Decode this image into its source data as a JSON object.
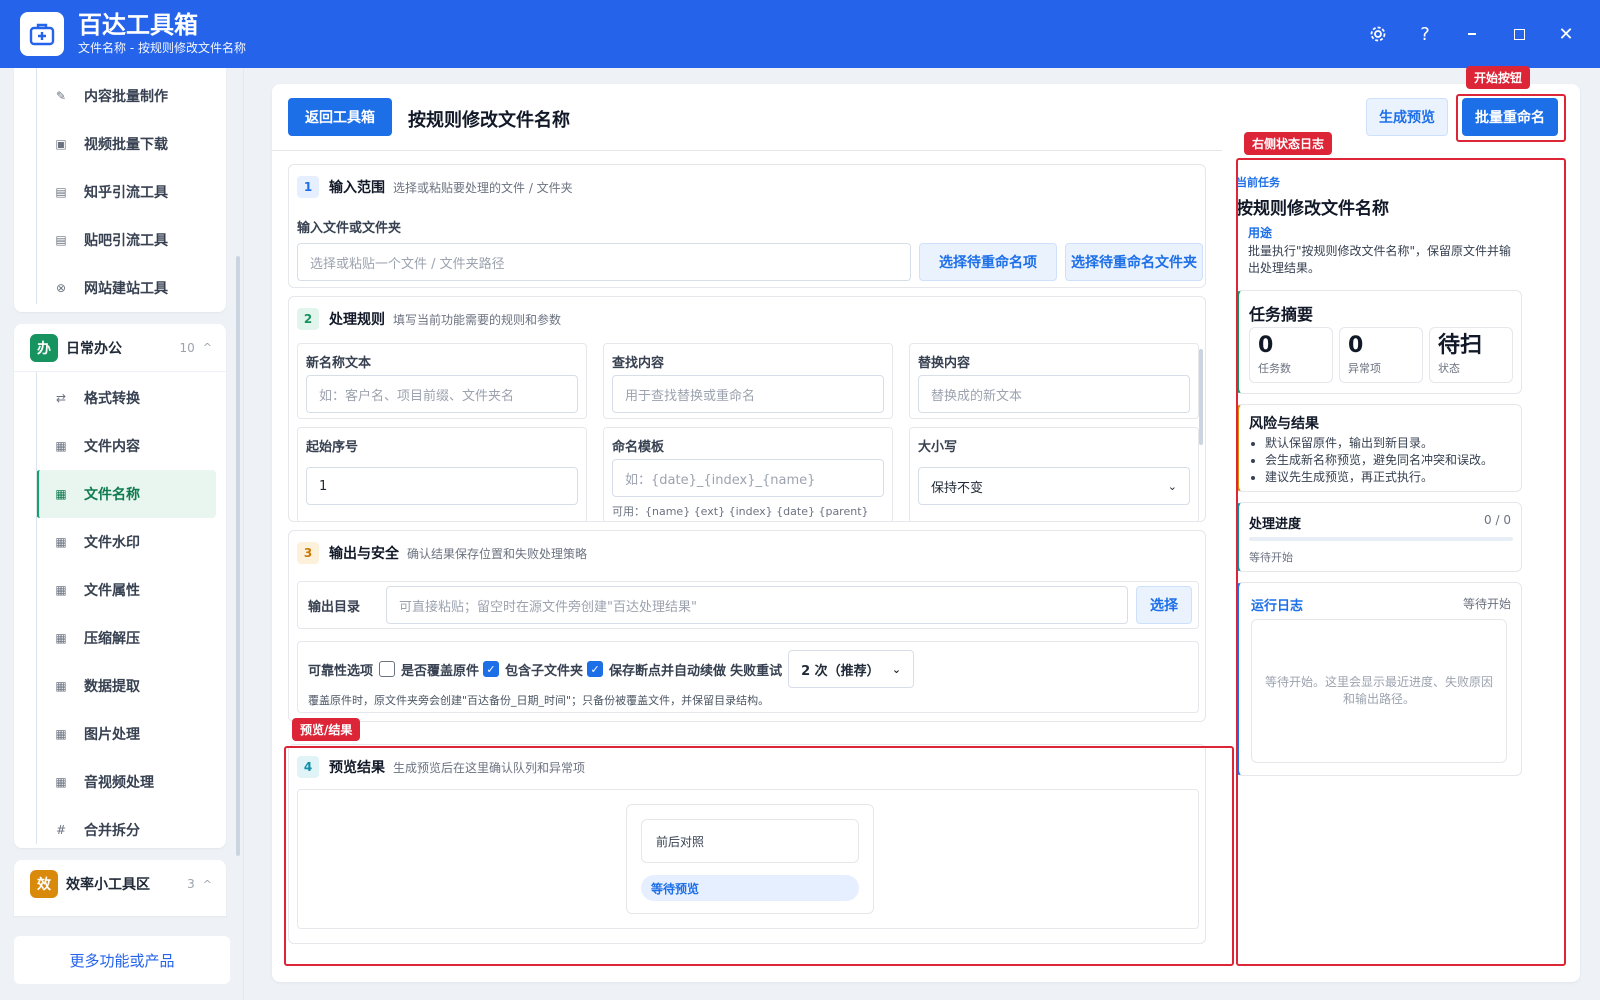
{
  "app": {
    "title": "百达工具箱",
    "subtitle": "文件名称 - 按规则修改文件名称",
    "window_controls": [
      "settings-icon",
      "help-icon",
      "minimize-icon",
      "maximize-icon",
      "close-icon"
    ]
  },
  "sidebar": {
    "top_items": [
      {
        "icon": "edit-icon",
        "label": "内容批量制作"
      },
      {
        "icon": "video-icon",
        "label": "视频批量下载"
      },
      {
        "icon": "zhihu-icon",
        "label": "知乎引流工具"
      },
      {
        "icon": "tieba-icon",
        "label": "贴吧引流工具"
      },
      {
        "icon": "globe-icon",
        "label": "网站建站工具"
      }
    ],
    "group_office": {
      "badge": "办",
      "name": "日常办公",
      "count": "10",
      "items": [
        {
          "icon": "swap-icon",
          "label": "格式转换"
        },
        {
          "icon": "grid-icon",
          "label": "文件内容"
        },
        {
          "icon": "grid-icon",
          "label": "文件名称"
        },
        {
          "icon": "grid-icon",
          "label": "文件水印"
        },
        {
          "icon": "grid-icon",
          "label": "文件属性"
        },
        {
          "icon": "grid-icon",
          "label": "压缩解压"
        },
        {
          "icon": "grid-icon",
          "label": "数据提取"
        },
        {
          "icon": "grid-icon",
          "label": "图片处理"
        },
        {
          "icon": "grid-icon",
          "label": "音视频处理"
        },
        {
          "icon": "hash-icon",
          "label": "合并拆分"
        }
      ],
      "active_index": 2
    },
    "group_efficiency": {
      "badge": "效",
      "name": "效率小工具区",
      "count": "3"
    },
    "more_label": "更多功能或产品"
  },
  "header": {
    "back_label": "返回工具箱",
    "title": "按规则修改文件名称",
    "preview_label": "生成预览",
    "rename_label": "批量重命名"
  },
  "section1": {
    "num": "1",
    "title": "输入范围",
    "desc": "选择或粘贴要处理的文件 / 文件夹",
    "field_label": "输入文件或文件夹",
    "placeholder": "选择或粘贴一个文件 / 文件夹路径",
    "btn_items": "选择待重命名项",
    "btn_folder": "选择待重命名文件夹"
  },
  "section2": {
    "num": "2",
    "title": "处理规则",
    "desc": "填写当前功能需要的规则和参数",
    "fields": {
      "new_name_label": "新名称文本",
      "new_name_placeholder": "如：客户名、项目前缀、文件夹名",
      "find_label": "查找内容",
      "find_placeholder": "用于查找替换或重命名",
      "replace_label": "替换内容",
      "replace_placeholder": "替换成的新文本",
      "start_label": "起始序号",
      "start_value": "1",
      "template_label": "命名模板",
      "template_placeholder": "如：{date}_{index}_{name}",
      "template_hint": "可用：{name} {ext} {index} {date} {parent}",
      "case_label": "大小写",
      "case_value": "保持不变"
    }
  },
  "section3": {
    "num": "3",
    "title": "输出与安全",
    "desc": "确认结果保存位置和失败处理策略",
    "output_label": "输出目录",
    "output_placeholder": "可直接粘贴；留空时在源文件旁创建\"百达处理结果\"",
    "choose_label": "选择",
    "reliability_label": "可靠性选项",
    "opt_overwrite": "是否覆盖原件",
    "opt_subfolders": "包含子文件夹",
    "opt_resume": "保存断点并自动续做",
    "retry_label": "失败重试",
    "retry_value": "2 次（推荐）",
    "note": "覆盖原件时，原文件夹旁会创建\"百达备份_日期_时间\"；只备份被覆盖文件，并保留目录结构。"
  },
  "section4": {
    "num": "4",
    "title": "预览结果",
    "desc": "生成预览后在这里确认队列和异常项",
    "compare_label": "前后对照",
    "waiting_label": "等待预览"
  },
  "annotations": {
    "start_button": "开始按钮",
    "right_log": "右侧状态日志",
    "preview_result": "预览/结果"
  },
  "right_panel": {
    "current_task_label": "当前任务",
    "task_title": "按规则修改文件名称",
    "usage_label": "用途",
    "usage_text": "批量执行\"按规则修改文件名称\"，保留原文件并输出处理结果。",
    "summary_title": "任务摘要",
    "stats": [
      {
        "value": "0",
        "label": "任务数"
      },
      {
        "value": "0",
        "label": "异常项"
      },
      {
        "value": "待扫",
        "label": "状态"
      }
    ],
    "risk_title": "风险与结果",
    "risk_items": [
      "默认保留原件，输出到新目录。",
      "会生成新名称预览，避免同名冲突和误改。",
      "建议先生成预览，再正式执行。"
    ],
    "progress_title": "处理进度",
    "progress_count": "0 / 0",
    "progress_value": 0,
    "progress_status": "等待开始",
    "log_title": "运行日志",
    "log_status": "等待开始",
    "log_placeholder": "等待开始。这里会显示最近进度、失败原因和输出路径。"
  },
  "colors": {
    "brand": "#2563eb",
    "primary_button": "#1d6fe8",
    "annotation_red": "#dc2638",
    "office_badge": "#16935e",
    "efficiency_badge": "#d98a0b"
  }
}
